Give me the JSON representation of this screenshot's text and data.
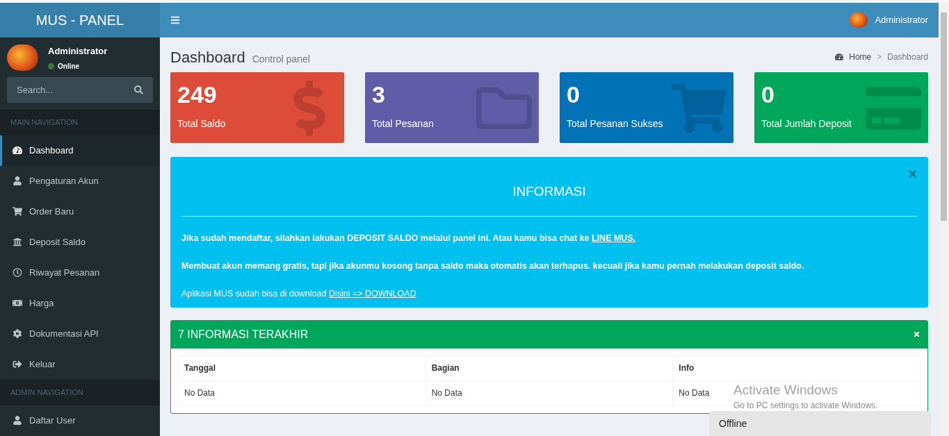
{
  "brand": "MUS - PANEL",
  "user": {
    "name": "Administrator",
    "status": "Online"
  },
  "search": {
    "placeholder": "Search..."
  },
  "sidebar": [
    {
      "kind": "header",
      "label": "MAIN NAVIGATION"
    },
    {
      "kind": "item",
      "label": "Dashboard",
      "selected": true
    },
    {
      "kind": "item",
      "label": "Pengaturan Akun",
      "selected": false
    },
    {
      "kind": "item",
      "label": "Order Baru",
      "selected": false
    },
    {
      "kind": "item",
      "label": "Deposit Saldo",
      "selected": false
    },
    {
      "kind": "item",
      "label": "Riwayat Pesanan",
      "selected": false
    },
    {
      "kind": "item",
      "label": "Harga",
      "selected": false
    },
    {
      "kind": "item",
      "label": "Dokumentasi API",
      "selected": false
    },
    {
      "kind": "item",
      "label": "Keluar",
      "selected": false
    },
    {
      "kind": "header",
      "label": "ADMIN NAVIGATION"
    },
    {
      "kind": "item",
      "label": "Daftar User",
      "selected": false
    }
  ],
  "header": {
    "user": "Administrator"
  },
  "page": {
    "title": "Dashboard",
    "subtitle": "Control panel",
    "breadcrumb": [
      "Home",
      "Dashboard"
    ],
    "separator": ">"
  },
  "stats": [
    {
      "value": "249",
      "label": "Total Saldo",
      "color": "#dd4b39"
    },
    {
      "value": "3",
      "label": "Total Pesanan",
      "color": "#605ca8"
    },
    {
      "value": "0",
      "label": "Total Pesanan Sukses",
      "color": "#0073b7"
    },
    {
      "value": "0",
      "label": "Total Jumlah Deposit",
      "color": "#00a65a"
    }
  ],
  "info": {
    "title": "INFORMASI",
    "close": "×",
    "paragraphs": [
      {
        "text": "Jika sudah mendaftar, silahkan lakukan DEPOSIT SALDO melalui panel ini. Atau kamu bisa chat ke",
        "bold": true,
        "link": "LINE MUS."
      },
      {
        "text": "Membuat akun memang gratis, tapi jika akunmu kosong tanpa saldo maka otomatis akan terhapus. kecuali jika kamu pernah melakukan deposit saldo.",
        "bold": true
      },
      {
        "text": "Aplikasi MUS sudah bisa di download",
        "bold": false,
        "link": "Disini => DOWNLOAD"
      }
    ]
  },
  "latest": {
    "title": "7 INFORMASI TERAKHIR",
    "columns": [
      "Tanggal",
      "Bagian",
      "Info"
    ],
    "rows": [
      [
        "No Data",
        "No Data",
        "No Data"
      ]
    ]
  },
  "chat": {
    "status": "Offline"
  },
  "os_notice": {
    "title": "Activate Windows",
    "text": "Go to PC settings to activate Windows."
  }
}
